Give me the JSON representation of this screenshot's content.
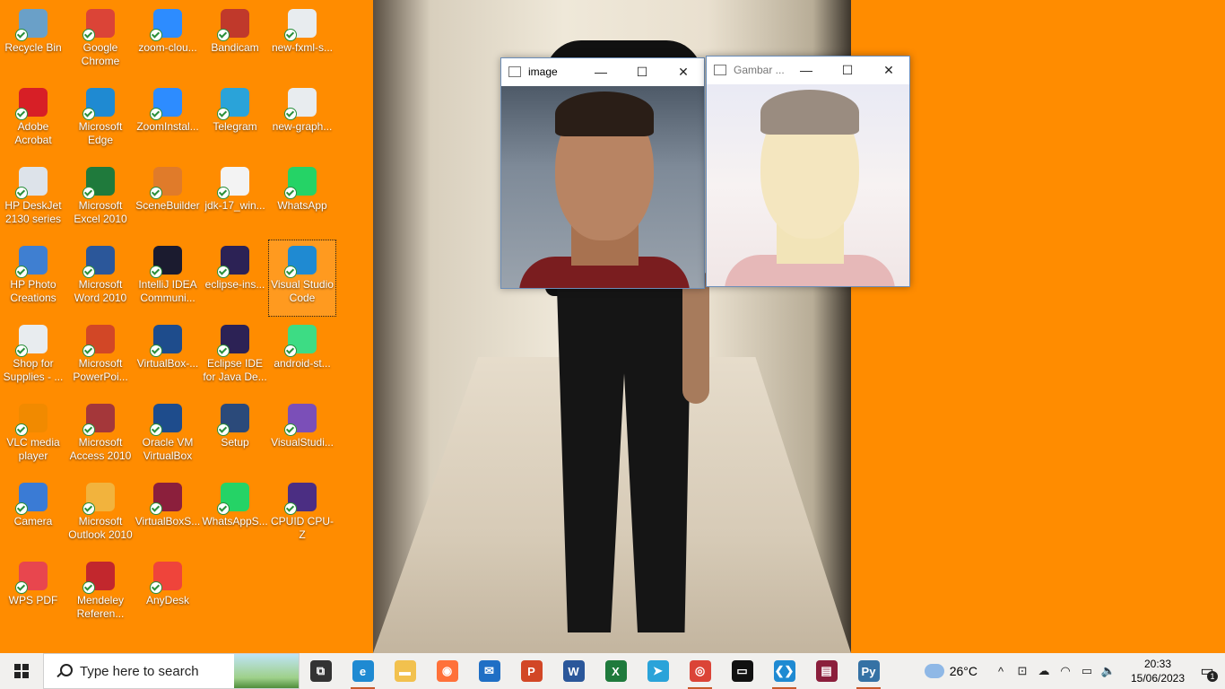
{
  "desktop": {
    "icons": [
      {
        "label": "Recycle Bin",
        "icon": "recycle-bin-icon",
        "color": "#6aa0c8"
      },
      {
        "label": "Google Chrome",
        "icon": "chrome-icon",
        "color": "#db4437"
      },
      {
        "label": "zoom-clou...",
        "icon": "zoom-icon",
        "color": "#2d8cff"
      },
      {
        "label": "Bandicam",
        "icon": "bandicam-icon",
        "color": "#c0392b"
      },
      {
        "label": "new-fxml-s...",
        "icon": "document-icon",
        "color": "#e8ecef"
      },
      {
        "label": "Adobe Acrobat",
        "icon": "acrobat-icon",
        "color": "#d71f26"
      },
      {
        "label": "Microsoft Edge",
        "icon": "edge-icon",
        "color": "#1f8ad2"
      },
      {
        "label": "ZoomInstal...",
        "icon": "zoom-icon",
        "color": "#2d8cff"
      },
      {
        "label": "Telegram",
        "icon": "telegram-icon",
        "color": "#2aa3d9"
      },
      {
        "label": "new-graph...",
        "icon": "document-icon",
        "color": "#e8ecef"
      },
      {
        "label": "HP DeskJet 2130 series",
        "icon": "printer-icon",
        "color": "#dde3ea"
      },
      {
        "label": "Microsoft Excel 2010",
        "icon": "excel-icon",
        "color": "#1f7a3c"
      },
      {
        "label": "SceneBuilder",
        "icon": "scenebuilder-icon",
        "color": "#e07b2a"
      },
      {
        "label": "jdk-17_win...",
        "icon": "java-icon",
        "color": "#f3f3f3"
      },
      {
        "label": "WhatsApp",
        "icon": "whatsapp-icon",
        "color": "#25d366"
      },
      {
        "label": "HP Photo Creations",
        "icon": "hp-photo-icon",
        "color": "#3f7fd1"
      },
      {
        "label": "Microsoft Word 2010",
        "icon": "word-icon",
        "color": "#2b579a"
      },
      {
        "label": "IntelliJ IDEA Communi...",
        "icon": "intellij-icon",
        "color": "#1b1b2f"
      },
      {
        "label": "eclipse-ins...",
        "icon": "eclipse-installer-icon",
        "color": "#2c2255"
      },
      {
        "label": "Visual Studio Code",
        "icon": "vscode-icon",
        "color": "#1f8ad2"
      },
      {
        "label": "Shop for Supplies - ...",
        "icon": "shop-supplies-icon",
        "color": "#e8ecef"
      },
      {
        "label": "Microsoft PowerPoi...",
        "icon": "powerpoint-icon",
        "color": "#d24726"
      },
      {
        "label": "VirtualBox-...",
        "icon": "virtualbox-icon",
        "color": "#1e4c8c"
      },
      {
        "label": "Eclipse IDE for Java De...",
        "icon": "eclipse-icon",
        "color": "#2c2255"
      },
      {
        "label": "android-st...",
        "icon": "android-studio-icon",
        "color": "#3ddc84"
      },
      {
        "label": "VLC media player",
        "icon": "vlc-icon",
        "color": "#f18a00"
      },
      {
        "label": "Microsoft Access 2010",
        "icon": "access-icon",
        "color": "#a4373a"
      },
      {
        "label": "Oracle VM VirtualBox",
        "icon": "virtualbox-icon",
        "color": "#1e4c8c"
      },
      {
        "label": "Setup",
        "icon": "setup-icon",
        "color": "#2b4a7a"
      },
      {
        "label": "VisualStudi...",
        "icon": "visual-studio-icon",
        "color": "#7b4fb8"
      },
      {
        "label": "Camera",
        "icon": "camera-icon",
        "color": "#3a7bd5"
      },
      {
        "label": "Microsoft Outlook 2010",
        "icon": "outlook-icon",
        "color": "#f2b33d"
      },
      {
        "label": "VirtualBoxS...",
        "icon": "winrar-icon",
        "color": "#8b1f3c"
      },
      {
        "label": "WhatsAppS...",
        "icon": "whatsapp-icon",
        "color": "#25d366"
      },
      {
        "label": "CPUID CPU-Z",
        "icon": "cpuz-icon",
        "color": "#4b2e83"
      },
      {
        "label": "WPS PDF",
        "icon": "wps-pdf-icon",
        "color": "#e8464e"
      },
      {
        "label": "Mendeley Referen...",
        "icon": "mendeley-icon",
        "color": "#c2272d"
      },
      {
        "label": "AnyDesk",
        "icon": "anydesk-icon",
        "color": "#ef443b"
      }
    ],
    "selected_icon": "Visual Studio Code"
  },
  "windows": [
    {
      "title": "image",
      "variant": "normal"
    },
    {
      "title": "Gambar ...",
      "variant": "brightened"
    }
  ],
  "window_controls": {
    "minimize": "—",
    "maximize": "☐",
    "close": "✕"
  },
  "taskbar": {
    "search_placeholder": "Type here to search",
    "apps": [
      {
        "name": "task-view",
        "glyph": "⧉",
        "color": "#333"
      },
      {
        "name": "edge",
        "glyph": "e",
        "color": "#1f8ad2",
        "open": true
      },
      {
        "name": "file-explorer",
        "glyph": "▬",
        "color": "#f2c14e"
      },
      {
        "name": "firefox",
        "glyph": "◉",
        "color": "#ff7139"
      },
      {
        "name": "mail",
        "glyph": "✉",
        "color": "#1f6fc5"
      },
      {
        "name": "powerpoint",
        "glyph": "P",
        "color": "#d24726"
      },
      {
        "name": "word",
        "glyph": "W",
        "color": "#2b579a"
      },
      {
        "name": "excel",
        "glyph": "X",
        "color": "#1f7a3c"
      },
      {
        "name": "telegram",
        "glyph": "➤",
        "color": "#2aa3d9"
      },
      {
        "name": "chrome",
        "glyph": "◎",
        "color": "#db4437",
        "open": true
      },
      {
        "name": "terminal",
        "glyph": "▭",
        "color": "#111"
      },
      {
        "name": "vscode",
        "glyph": "❮❯",
        "color": "#1f8ad2",
        "open": true
      },
      {
        "name": "winrar",
        "glyph": "▤",
        "color": "#8b1f3c"
      },
      {
        "name": "python",
        "glyph": "Py",
        "color": "#3572a5",
        "open": true
      }
    ],
    "weather_temp": "26°C",
    "tray_icons": [
      "^",
      "⊡",
      "☁",
      "◠",
      "▭",
      "🔈"
    ],
    "time": "20:33",
    "date": "15/06/2023",
    "notification_count": "1"
  }
}
